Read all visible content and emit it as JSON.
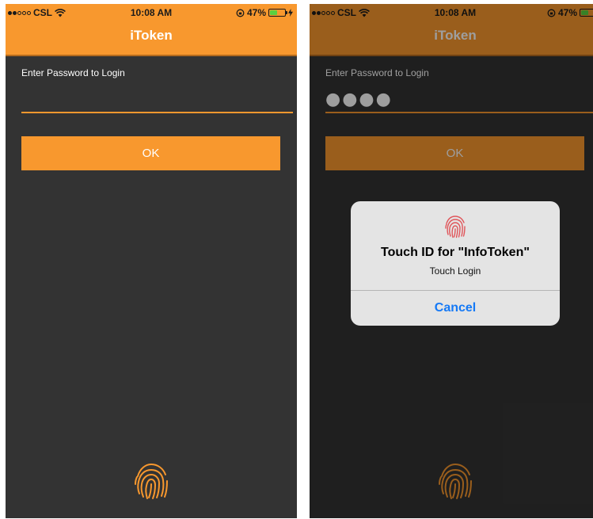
{
  "colors": {
    "accent": "#f8982e",
    "background": "#333333",
    "alert_background": "#e4e4e4",
    "alert_button": "#1479f6",
    "fingerprint": "#f8982e",
    "touchid_icon": "#e0555a"
  },
  "status_bar": {
    "carrier": "CSL",
    "time": "10:08 AM",
    "battery": "47%",
    "battery_level": 0.47
  },
  "app": {
    "title": "iToken"
  },
  "login": {
    "label": "Enter Password to Login",
    "ok_label": "OK",
    "fingerprint_icon": "fingerprint-icon"
  },
  "screens": [
    {
      "password_value": ""
    },
    {
      "password_value": "●●●●"
    }
  ],
  "touch_id_alert": {
    "icon": "fingerprint-icon",
    "title": "Touch ID for \"InfoToken\"",
    "message": "Touch Login",
    "cancel_label": "Cancel"
  }
}
